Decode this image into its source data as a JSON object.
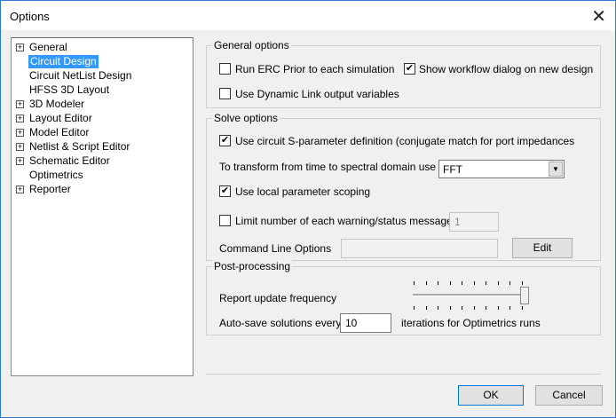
{
  "window": {
    "title": "Options"
  },
  "tree": [
    {
      "label": "General",
      "expandable": true
    },
    {
      "label": "Circuit Design",
      "expandable": false,
      "selected": true
    },
    {
      "label": "Circuit NetList Design",
      "expandable": false
    },
    {
      "label": "HFSS 3D Layout",
      "expandable": false
    },
    {
      "label": "3D Modeler",
      "expandable": true
    },
    {
      "label": "Layout Editor",
      "expandable": true
    },
    {
      "label": "Model Editor",
      "expandable": true
    },
    {
      "label": "Netlist & Script Editor",
      "expandable": true
    },
    {
      "label": "Schematic Editor",
      "expandable": true
    },
    {
      "label": "Optimetrics",
      "expandable": false
    },
    {
      "label": "Reporter",
      "expandable": true
    }
  ],
  "general": {
    "title": "General options",
    "run_erc": {
      "label": "Run ERC Prior to each simulation",
      "checked": false
    },
    "show_workflow": {
      "label": "Show workflow dialog on new design",
      "checked": true
    },
    "dynamic_link": {
      "label": "Use Dynamic Link output variables",
      "checked": false
    }
  },
  "solve": {
    "title": "Solve options",
    "sparam": {
      "label": "Use circuit S-parameter definition (conjugate match for port  impedances",
      "checked": true
    },
    "transform_label": "To transform from time to spectral domain use",
    "transform_value": "FFT",
    "local_scoping": {
      "label": "Use local parameter scoping",
      "checked": true
    },
    "limit": {
      "label": "Limit number of each warning/status message",
      "checked": false,
      "value": "1"
    },
    "cmd_label": "Command Line Options",
    "cmd_value": "",
    "edit_label": "Edit"
  },
  "post": {
    "title": "Post-processing",
    "report_label": "Report update frequency",
    "report_level": 1.0,
    "autosave_label": "Auto-save solutions every",
    "autosave_value": "10",
    "autosave_suffix": "iterations for Optimetrics runs"
  },
  "buttons": {
    "ok": "OK",
    "cancel": "Cancel"
  },
  "check_mark": "✔"
}
